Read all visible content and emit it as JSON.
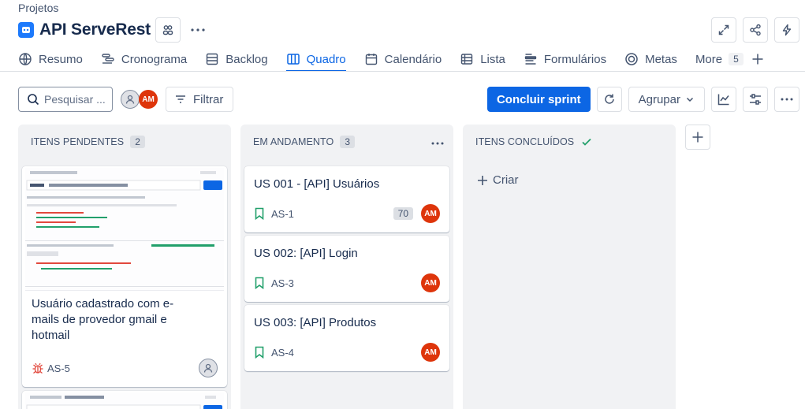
{
  "breadcrumb": "Projetos",
  "project": {
    "title": "API ServeRest"
  },
  "tabs": [
    {
      "label": "Resumo",
      "icon": "globe-icon"
    },
    {
      "label": "Cronograma",
      "icon": "timeline-icon"
    },
    {
      "label": "Backlog",
      "icon": "backlog-icon"
    },
    {
      "label": "Quadro",
      "icon": "board-icon",
      "active": true
    },
    {
      "label": "Calendário",
      "icon": "calendar-icon"
    },
    {
      "label": "Lista",
      "icon": "list-icon"
    },
    {
      "label": "Formulários",
      "icon": "forms-icon"
    },
    {
      "label": "Metas",
      "icon": "goals-icon"
    },
    {
      "label": "More",
      "count": "5"
    }
  ],
  "toolbar": {
    "search_placeholder": "Pesquisar ...",
    "avatar_initials": "AM",
    "filter_label": "Filtrar",
    "complete_sprint_label": "Concluir sprint",
    "group_label": "Agrupar"
  },
  "columns": [
    {
      "title": "ITENS PENDENTES",
      "count": "2",
      "cards": [
        {
          "title": "Usuário cadastrado com e-mails de provedor gmail e hotmail",
          "key": "AS-5",
          "type": "bug"
        }
      ]
    },
    {
      "title": "EM ANDAMENTO",
      "count": "3",
      "cards": [
        {
          "title": "US 001 - [API] Usuários",
          "key": "AS-1",
          "estimate": "70",
          "assignee": "AM"
        },
        {
          "title": "US 002: [API] Login",
          "key": "AS-3",
          "assignee": "AM"
        },
        {
          "title": "US 003: [API] Produtos",
          "key": "AS-4",
          "assignee": "AM"
        }
      ]
    },
    {
      "title": "ITENS CONCLUÍDOS",
      "create_label": "Criar"
    }
  ],
  "colors": {
    "primary": "#0c66e4",
    "avatar": "#de350b",
    "story": "#22a06b",
    "bug": "#e2483d",
    "done_check": "#22a06b"
  }
}
